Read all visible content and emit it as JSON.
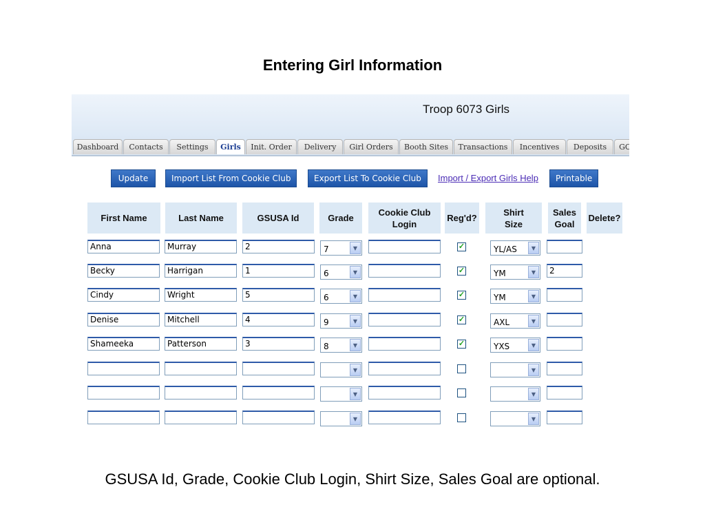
{
  "slide": {
    "title": "Entering Girl Information",
    "caption": "GSUSA Id, Grade, Cookie Club Login, Shirt Size, Sales Goal are optional."
  },
  "app": {
    "title": "Troop 6073 Girls",
    "tabs": [
      "Dashboard",
      "Contacts",
      "Settings",
      "Girls",
      "Init. Order",
      "Delivery",
      "Girl Orders",
      "Booth Sites",
      "Transactions",
      "Incentives",
      "Deposits",
      "GO"
    ],
    "active_tab": "Girls",
    "toolbar": {
      "update": "Update",
      "import": "Import List From Cookie Club",
      "export": "Export List To Cookie Club",
      "help": "Import / Export Girls Help",
      "printable": "Printable"
    },
    "columns": [
      "First Name",
      "Last Name",
      "GSUSA Id",
      "Grade",
      "Cookie Club Login",
      "Reg'd?",
      "Shirt Size",
      "Sales Goal",
      "Delete?"
    ],
    "rows": [
      {
        "first": "Anna",
        "last": "Murray",
        "gsusa": "2",
        "grade": "7",
        "login": "",
        "regd": true,
        "shirt": "YL/AS",
        "goal": ""
      },
      {
        "first": "Becky",
        "last": "Harrigan",
        "gsusa": "1",
        "grade": "6",
        "login": "",
        "regd": true,
        "shirt": "YM",
        "goal": "2"
      },
      {
        "first": "Cindy",
        "last": "Wright",
        "gsusa": "5",
        "grade": "6",
        "login": "",
        "regd": true,
        "shirt": "YM",
        "goal": ""
      },
      {
        "first": "Denise",
        "last": "Mitchell",
        "gsusa": "4",
        "grade": "9",
        "login": "",
        "regd": true,
        "shirt": "AXL",
        "goal": ""
      },
      {
        "first": "Shameeka",
        "last": "Patterson",
        "gsusa": "3",
        "grade": "8",
        "login": "",
        "regd": true,
        "shirt": "YXS",
        "goal": ""
      },
      {
        "first": "",
        "last": "",
        "gsusa": "",
        "grade": "",
        "login": "",
        "regd": false,
        "shirt": "",
        "goal": ""
      },
      {
        "first": "",
        "last": "",
        "gsusa": "",
        "grade": "",
        "login": "",
        "regd": false,
        "shirt": "",
        "goal": ""
      },
      {
        "first": "",
        "last": "",
        "gsusa": "",
        "grade": "",
        "login": "",
        "regd": false,
        "shirt": "",
        "goal": ""
      }
    ]
  },
  "icons": {
    "dropdown": "chevron-down-icon",
    "checkbox": "checkmark-icon"
  },
  "colors": {
    "banner": "#dce8f5",
    "button": "#2a63b5",
    "header_cell": "#dce9f5",
    "link": "#4a2bb5",
    "check": "#21a121"
  }
}
